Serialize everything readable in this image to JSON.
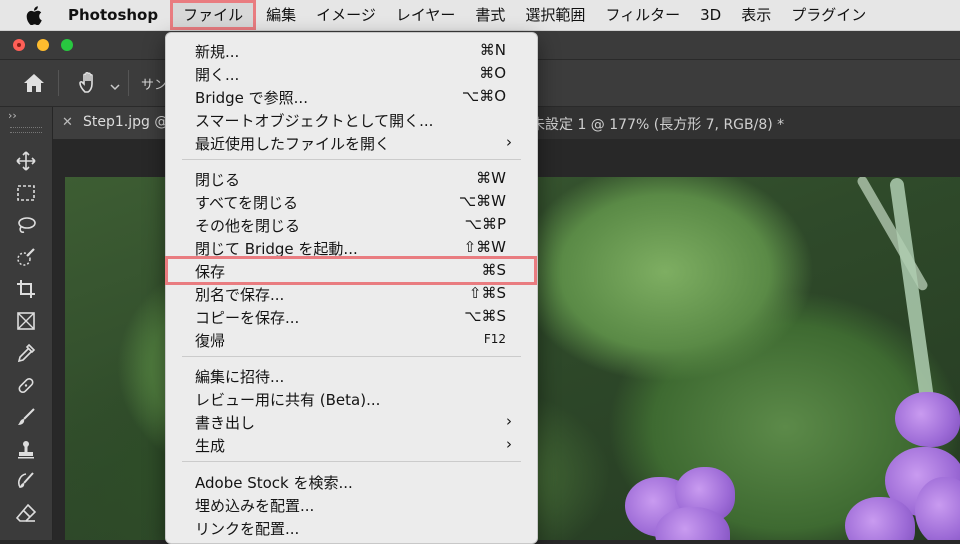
{
  "menubar": {
    "app_name": "Photoshop",
    "items": [
      "ファイル",
      "編集",
      "イメージ",
      "レイヤー",
      "書式",
      "選択範囲",
      "フィルター",
      "3D",
      "表示",
      "プラグイン"
    ]
  },
  "options_bar": {
    "sample_label": "サン"
  },
  "tabs": {
    "first": "Step1.jpg @",
    "second": "未設定 1 @ 177% (長方形 7, RGB/8) *"
  },
  "file_menu": {
    "items": [
      {
        "label": "新規...",
        "shortcut": "⌘N"
      },
      {
        "label": "開く...",
        "shortcut": "⌘O"
      },
      {
        "label": "Bridge で参照...",
        "shortcut": "⌥⌘O"
      },
      {
        "label": "スマートオブジェクトとして開く...",
        "shortcut": ""
      },
      {
        "label": "最近使用したファイルを開く",
        "shortcut": "",
        "submenu": "›"
      },
      {
        "label": "閉じる",
        "shortcut": "⌘W"
      },
      {
        "label": "すべてを閉じる",
        "shortcut": "⌥⌘W"
      },
      {
        "label": "その他を閉じる",
        "shortcut": "⌥⌘P"
      },
      {
        "label": "閉じて Bridge を起動...",
        "shortcut": "⇧⌘W"
      },
      {
        "label": "保存",
        "shortcut": "⌘S"
      },
      {
        "label": "別名で保存...",
        "shortcut": "⇧⌘S"
      },
      {
        "label": "コピーを保存...",
        "shortcut": "⌥⌘S"
      },
      {
        "label": "復帰",
        "shortcut": "F12"
      },
      {
        "label": "編集に招待...",
        "shortcut": ""
      },
      {
        "label": "レビュー用に共有 (Beta)...",
        "shortcut": ""
      },
      {
        "label": "書き出し",
        "shortcut": "",
        "submenu": "›"
      },
      {
        "label": "生成",
        "shortcut": "",
        "submenu": "›"
      },
      {
        "label": "Adobe Stock を検索...",
        "shortcut": ""
      },
      {
        "label": "埋め込みを配置...",
        "shortcut": ""
      },
      {
        "label": "リンクを配置...",
        "shortcut": ""
      }
    ]
  },
  "colors": {
    "highlight": "#e97c80",
    "menu_bg": "#ececec",
    "panel_bg": "#3b3b3b"
  }
}
